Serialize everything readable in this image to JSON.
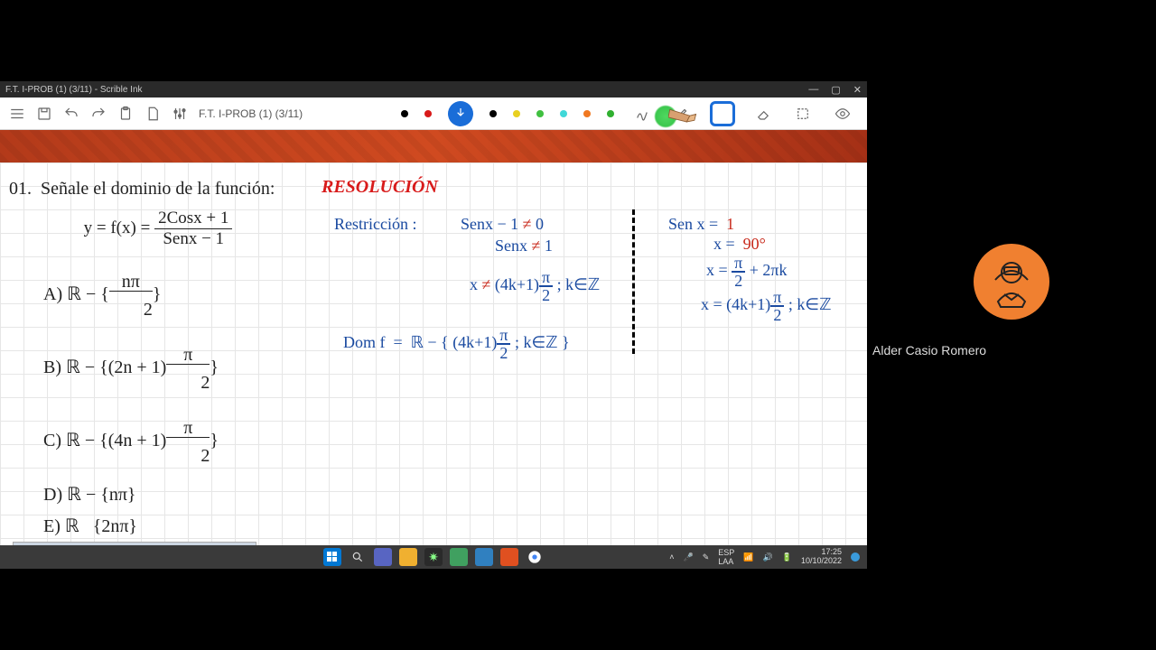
{
  "window": {
    "title": "F.T. I-PROB (1) (3/11) - Scrible Ink",
    "doc_title": "F.T. I-PROB (1) (3/11)"
  },
  "toolbar": {
    "colors": [
      "#000000",
      "#d81a1a",
      "#1a6dd8",
      "#000000",
      "#e8d020",
      "#40c040",
      "#40d8d8",
      "#f07820",
      "#30b030"
    ],
    "selected_color_index": 2
  },
  "problem": {
    "number": "01.",
    "prompt": "Señale el dominio de la función:",
    "func_lhs": "y = f(x) =",
    "func_num": "2Cosx + 1",
    "func_den": "Senx − 1",
    "options": {
      "A": "ℝ − { nπ / 2 }",
      "B": "ℝ − { (2n + 1) π/2 }",
      "C": "ℝ − { (4n + 1) π/2 }",
      "D": "ℝ − {nπ}",
      "E": "ℝ − {2nπ}"
    }
  },
  "resolution_label": "RESOLUCIÓN",
  "work": {
    "restr_label": "Restricción :",
    "l1a": "Senx − 1",
    "l1b": "≠",
    "l1c": "0",
    "l2a": "Senx",
    "l2b": "≠",
    "l2c": "1",
    "l3a": "x",
    "l3b": "≠",
    "l3c": "(4k+1)π/2 ; k∈ℤ",
    "dom": "Dom f  =  ℝ − { (4k+1)π/2 ; k∈ℤ }",
    "r1": "Sen x =  1",
    "r2": "x =  90°",
    "r3": "x =  π/2 + 2πk",
    "r4": "x =  (4k+1)π/2 ; k∈ℤ"
  },
  "taskbar": {
    "lang1": "ESP",
    "lang2": "LAA",
    "time": "17:25",
    "date": "10/10/2022"
  },
  "participant": {
    "name": "Alder Casio Romero"
  }
}
